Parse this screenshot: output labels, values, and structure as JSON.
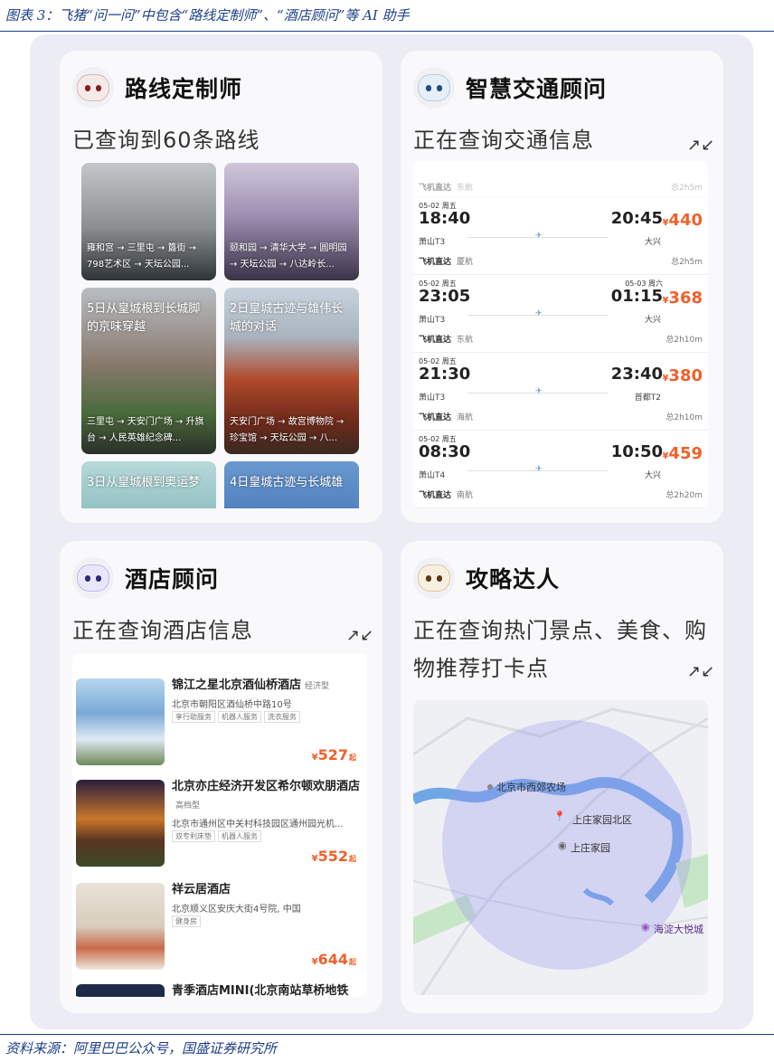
{
  "caption": "图表 3：飞猪“问一问”中包含“路线定制师”、“酒店顾问”等 AI 助手",
  "source": "资料来源：阿里巴巴公众号，国盛证券研究所",
  "cards": {
    "route": {
      "title": "路线定制师",
      "status": "已查询到60条路线",
      "tiles": [
        {
          "title": "",
          "path": "雍和宫 → 三里屯 → 簋街 → 798艺术区 → 天坛公园..."
        },
        {
          "title": "",
          "path": "颐和园 → 清华大学 → 圆明园 → 天坛公园 → 八达岭长..."
        },
        {
          "title": "5日从皇城根到长城脚的京味穿越",
          "path": "三里屯 → 天安门广场 → 升旗台 → 人民英雄纪念碑..."
        },
        {
          "title": "2日皇城古迹与雄伟长城的对话",
          "path": "天安门广场 → 故宫博物院 → 珍宝馆 → 天坛公园 → 八..."
        },
        {
          "title": "3日从皇城根到奥运梦",
          "path": ""
        },
        {
          "title": "4日皇城古迹与长城雄",
          "path": ""
        }
      ]
    },
    "traffic": {
      "title": "智慧交通顾问",
      "status": "正在查询交通信息",
      "top_partial": {
        "airline": "飞机直达",
        "carrier": "东航",
        "duration": "总2h5m"
      },
      "flights": [
        {
          "date": "05-02 周五",
          "dep": "18:40",
          "arr_date": "",
          "arr": "20:45",
          "price": "440",
          "from": "萧山T3",
          "to": "大兴",
          "airline": "飞机直达",
          "carrier": "厦航",
          "duration": "总2h5m"
        },
        {
          "date": "05-02 周五",
          "dep": "23:05",
          "arr_date": "05-03 周六",
          "arr": "01:15",
          "price": "368",
          "from": "萧山T3",
          "to": "大兴",
          "airline": "飞机直达",
          "carrier": "东航",
          "duration": "总2h10m"
        },
        {
          "date": "05-02 周五",
          "dep": "21:30",
          "arr_date": "",
          "arr": "23:40",
          "price": "380",
          "from": "萧山T3",
          "to": "首都T2",
          "airline": "飞机直达",
          "carrier": "海航",
          "duration": "总2h10m"
        },
        {
          "date": "05-02 周五",
          "dep": "08:30",
          "arr_date": "",
          "arr": "10:50",
          "price": "459",
          "from": "萧山T4",
          "to": "大兴",
          "airline": "飞机直达",
          "carrier": "南航",
          "duration": "总2h20m"
        }
      ]
    },
    "hotel": {
      "title": "酒店顾问",
      "status": "正在查询酒店信息",
      "hotels": [
        {
          "name": "锦江之星北京酒仙桥酒店",
          "star": "经济型",
          "address": "北京市朝阳区酒仙桥中路10号",
          "tags": [
            "享行助服务",
            "机器人服务",
            "洗衣服务"
          ],
          "price": "527"
        },
        {
          "name": "北京亦庄经济开发区希尔顿欢朋酒店",
          "star": "高档型",
          "address": "北京市通州区中关村科技园区通州园光机...",
          "tags": [
            "双专利床垫",
            "机器人服务"
          ],
          "price": "552"
        },
        {
          "name": "祥云居酒店",
          "star": "",
          "address": "北京顺义区安庆大街4号院, 中国",
          "tags": [
            "健身房"
          ],
          "price": "644"
        },
        {
          "name": "青季酒店MINI(北京南站草桥地铁站",
          "star": "",
          "address": "",
          "tags": [],
          "price": ""
        }
      ]
    },
    "guide": {
      "title": "攻略达人",
      "status": "正在查询热门景点、美食、购物推荐打卡点",
      "map_labels": {
        "farm": "北京市西郊农场",
        "north": "上庄家园北区",
        "home": "上庄家园",
        "mall": "海淀大悦城"
      }
    }
  },
  "currency": "¥",
  "price_suffix": "起",
  "expand_icon": "↗↙",
  "colors": {
    "price": "#f0602b",
    "caption": "#1d3f88",
    "map_circle": "#9c95f0",
    "river": "#6fa7e6"
  }
}
